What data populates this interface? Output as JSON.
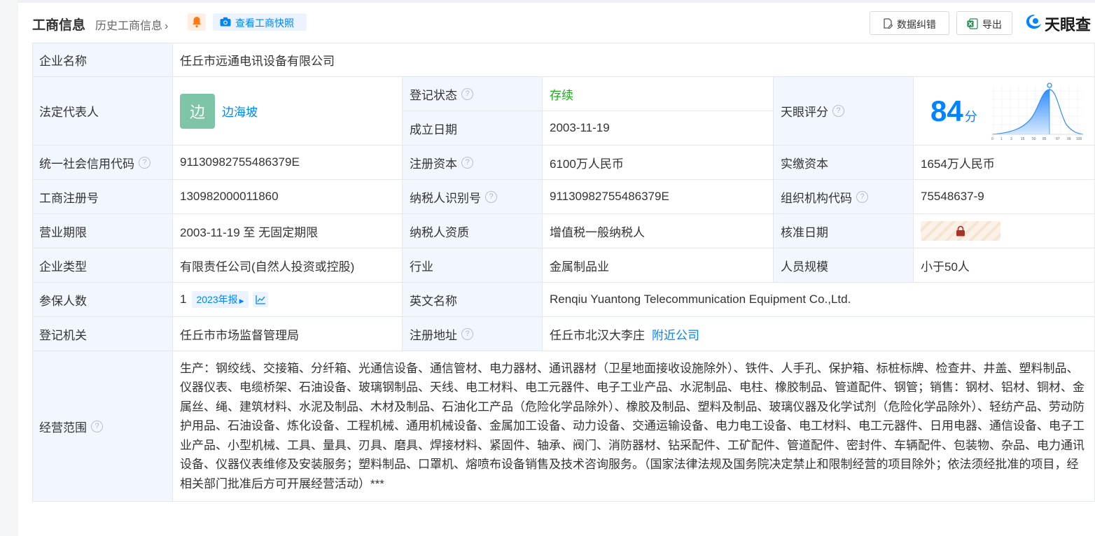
{
  "header": {
    "title": "工商信息",
    "history": "历史工商信息",
    "snapshot_button": "查看工商快照",
    "correct_button": "数据纠错",
    "export_button": "导出",
    "logo_text": "天眼查"
  },
  "rows": {
    "company_name_label": "企业名称",
    "company_name": "任丘市远通电讯设备有限公司",
    "legal_rep_label": "法定代表人",
    "legal_rep_avatar": "边",
    "legal_rep_name": "边海坡",
    "reg_status_label": "登记状态",
    "reg_status": "存续",
    "found_date_label": "成立日期",
    "found_date": "2003-11-19",
    "tianyan_label": "天眼评分",
    "score": "84",
    "score_unit": "分",
    "score_axis": [
      "0",
      "1",
      "3",
      "15",
      "50",
      "85",
      "97",
      "99",
      "100"
    ],
    "credit_code_label": "统一社会信用代码",
    "credit_code": "91130982755486379E",
    "reg_capital_label": "注册资本",
    "reg_capital": "6100万人民币",
    "paid_capital_label": "实缴资本",
    "paid_capital": "1654万人民币",
    "biz_reg_no_label": "工商注册号",
    "biz_reg_no": "130982000011860",
    "taxpayer_id_label": "纳税人识别号",
    "taxpayer_id": "91130982755486379E",
    "org_code_label": "组织机构代码",
    "org_code": "75548637-9",
    "term_label": "营业期限",
    "term": "2003-11-19 至 无固定期限",
    "taxpayer_qual_label": "纳税人资质",
    "taxpayer_qual": "增值税一般纳税人",
    "approve_date_label": "核准日期",
    "type_label": "企业类型",
    "type": "有限责任公司(自然人投资或控股)",
    "industry_label": "行业",
    "industry": "金属制品业",
    "staff_label": "人员规模",
    "staff": "小于50人",
    "insured_label": "参保人数",
    "insured": "1",
    "insured_report": "2023年报",
    "en_name_label": "英文名称",
    "en_name": "Renqiu Yuantong Telecommunication Equipment Co.,Ltd.",
    "authority_label": "登记机关",
    "authority": "任丘市市场监督管理局",
    "address_label": "注册地址",
    "address": "任丘市北汉大李庄",
    "nearby": "附近公司",
    "scope_label": "经营范围",
    "scope": "生产：钢绞线、交接箱、分纤箱、光通信设备、通信管材、电力器材、通讯器材（卫星地面接收设施除外）、铁件、人手孔、保护箱、标桩标牌、检查井、井盖、塑料制品、仪器仪表、电缆桥架、石油设备、玻璃钢制品、天线、电工材料、电工元器件、电子工业产品、水泥制品、电柱、橡胶制品、管道配件、钢管；销售：钢材、铝材、铜材、金属丝、绳、建筑材料、水泥及制品、木材及制品、石油化工产品（危险化学品除外）、橡胶及制品、塑料及制品、玻璃仪器及化学试剂（危险化学品除外）、轻纺产品、劳动防护用品、石油设备、炼化设备、工程机械、通用机械设备、金属加工设备、动力设备、交通运输设备、电力电工设备、电工材料、电工元器件、日用电器、通信设备、电子工业产品、小型机械、工具、量具、刃具、磨具、焊接材料、紧固件、轴承、阀门、消防器材、钻采配件、工矿配件、管道配件、密封件、车辆配件、包装物、杂品、电力通讯设备、仪器仪表维修及安装服务；塑料制品、口罩机、熔喷布设备销售及技术咨询服务。（国家法律法规及国务院决定禁止和限制经营的项目除外；依法须经批准的项目，经相关部门批准后方可开展经营活动）***"
  }
}
